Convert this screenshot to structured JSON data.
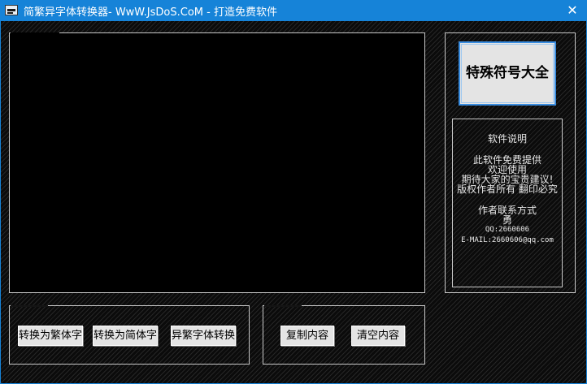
{
  "window": {
    "title": "简繁异字体转换器- WwW.JsDoS.CoM - 打造免费软件",
    "close_glyph": "✕"
  },
  "main_text": {
    "value": ""
  },
  "right_panel": {
    "special_button_label": "特殊符号大全",
    "info": {
      "title": "软件说明",
      "lines": [
        "此软件免费提供",
        "欢迎使用",
        "期待大家的宝贵建议!",
        "版权作者所有 翻印必究"
      ],
      "contact_title": "作者联系方式",
      "contact_name": "勇",
      "qq": "QQ:2660606",
      "email": "E-MAIL:2660606@qq.com"
    }
  },
  "convert_group": {
    "to_traditional": "转换为繁体字",
    "to_simplified": "转换为简体字",
    "variant": "异繁字体转换"
  },
  "edit_group": {
    "copy": "复制内容",
    "clear": "清空内容"
  }
}
